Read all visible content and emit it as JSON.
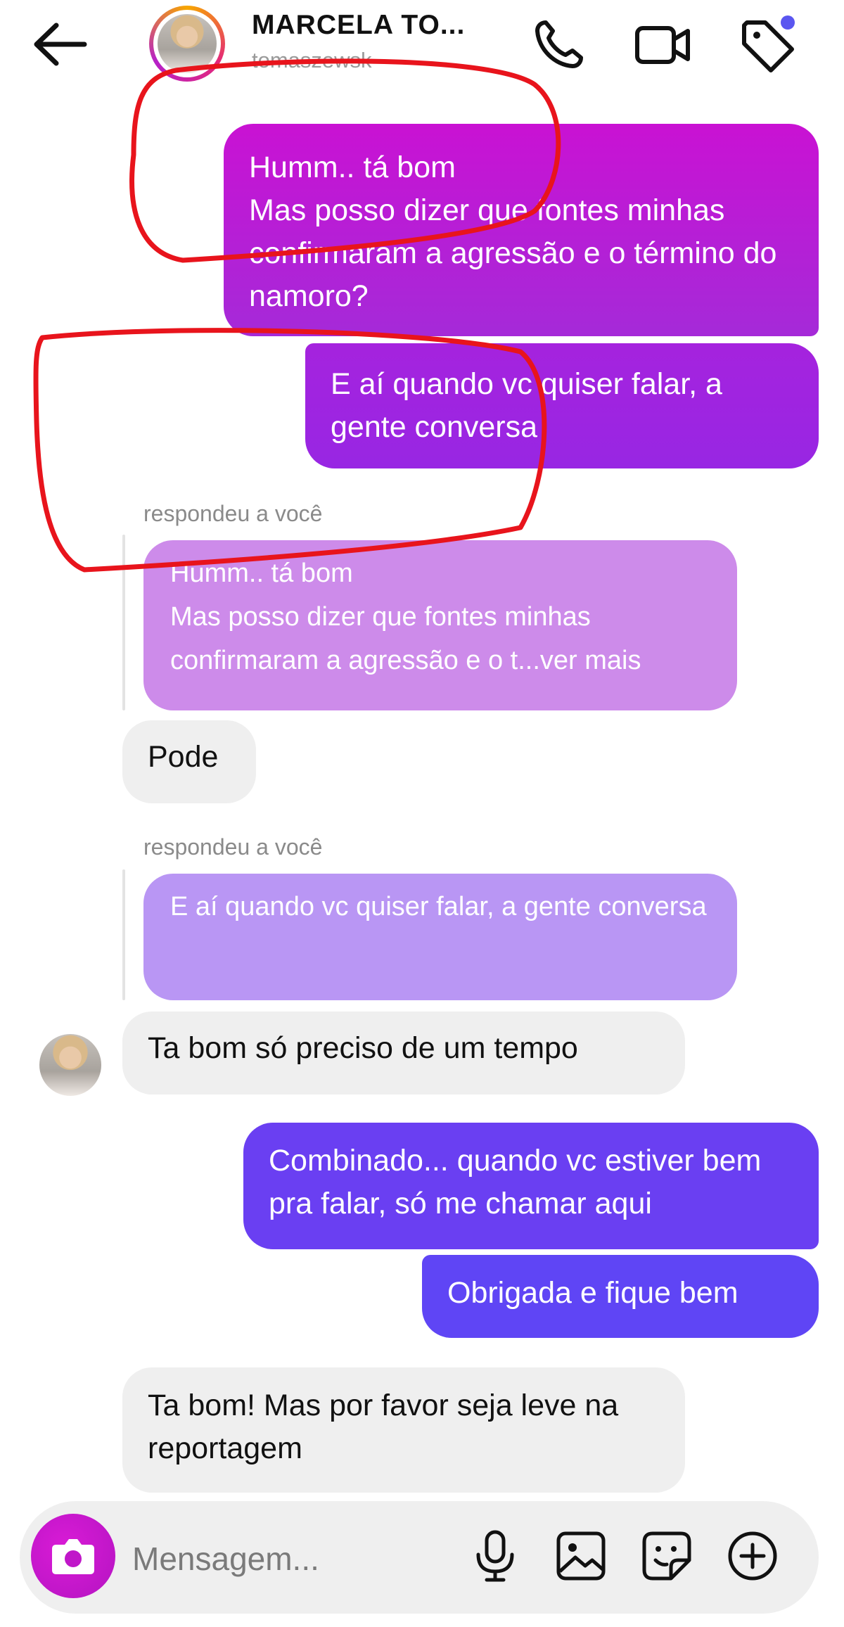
{
  "header": {
    "back_icon": "arrow-left-icon",
    "contact_name": "MARCELA TO...",
    "contact_username": "tomaszewsk",
    "icons": [
      "phone-icon",
      "video-camera-icon",
      "tag-icon"
    ],
    "accent": "#5a56f0"
  },
  "messages": {
    "out1": "Humm.. tá bom\nMas posso dizer que fontes minhas confirmaram a agressão e o término do namoro?",
    "out2": "E aí quando vc quiser falar, a gente  conversa",
    "reply_label_1": "respondeu a você",
    "quote1": "Humm.. tá bom\nMas posso dizer que fontes minhas confirmaram a agressão e o t...ver mais",
    "in1": "Pode",
    "reply_label_2": "respondeu a você",
    "quote2": "E aí quando vc quiser falar, a gente conversa",
    "in2": "Ta bom só preciso de um tempo",
    "out3": "Combinado... quando vc estiver bem pra falar, só me chamar aqui",
    "out4": "Obrigada e fique bem",
    "in3": "Ta bom! Mas por favor seja leve na reportagem"
  },
  "colors": {
    "out1": "#b41fd6",
    "out2": "#9f24e0",
    "out3": "#6a3ff2",
    "out4": "#5f45f5",
    "quote1": "#cd8bea",
    "quote2": "#b996f4",
    "incoming": "#efefef",
    "annotation": "#e8141c"
  },
  "composer": {
    "placeholder": "Mensagem...",
    "icons": [
      "camera-icon",
      "microphone-icon",
      "gallery-icon",
      "sticker-icon",
      "plus-circle-icon"
    ]
  }
}
